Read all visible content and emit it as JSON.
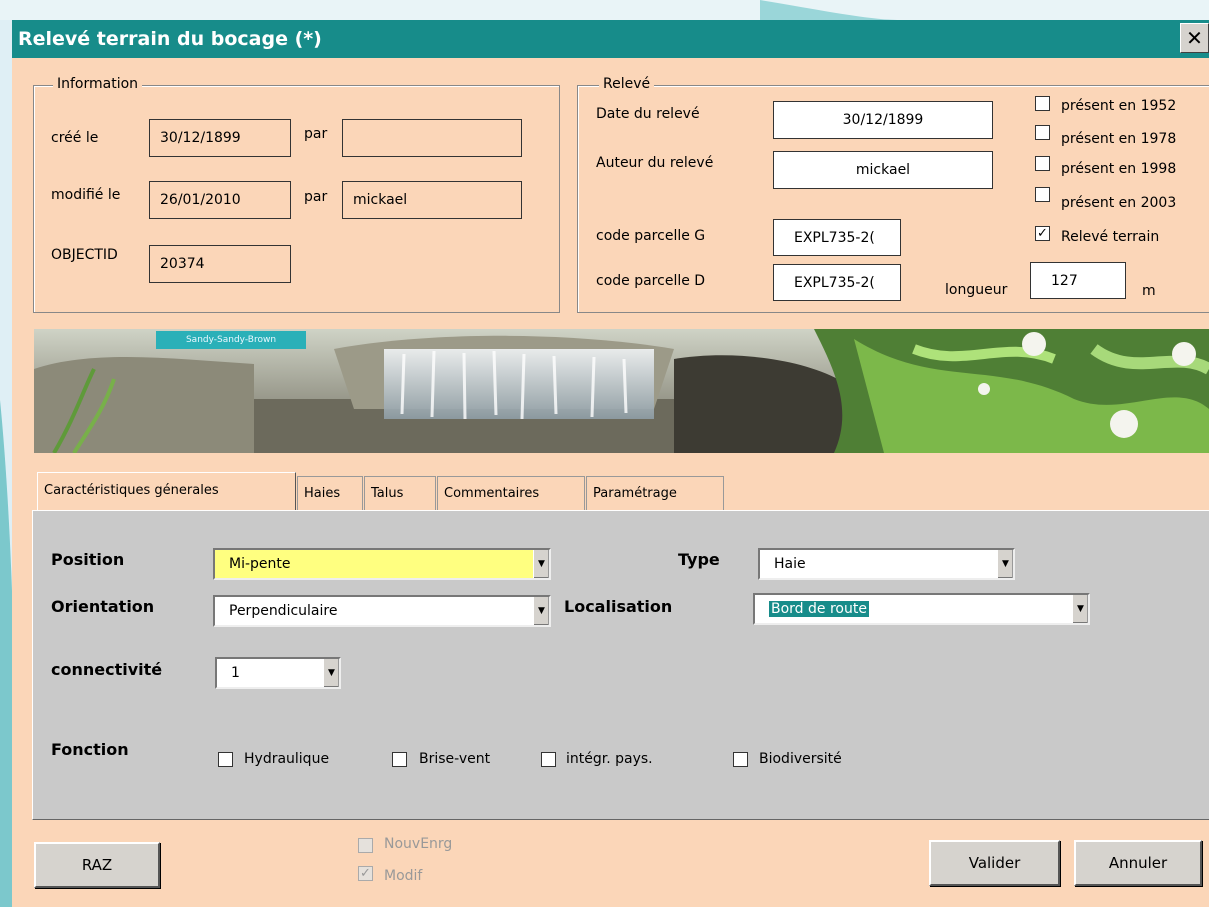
{
  "window": {
    "title": "Relevé terrain du bocage (*)",
    "close_glyph": "✕"
  },
  "information": {
    "legend": "Information",
    "cree_label": "créé le",
    "cree_value": "30/12/1899",
    "par1_label": "par",
    "par1_value": "",
    "modifie_label": "modifié le",
    "modifie_value": "26/01/2010",
    "par2_label": "par",
    "par2_value": "mickael",
    "objectid_label": "OBJECTID",
    "objectid_value": "20374"
  },
  "releve": {
    "legend": "Relevé",
    "date_label": "Date du relevé",
    "date_value": "30/12/1899",
    "auteur_label": "Auteur du relevé",
    "auteur_value": "mickael",
    "parcelle_g_label": "code parcelle G",
    "parcelle_g_value": "EXPL735-2(",
    "parcelle_d_label": "code parcelle D",
    "parcelle_d_value": "EXPL735-2(",
    "longueur_label": "longueur",
    "longueur_value": "127",
    "unit": "m",
    "checks": [
      {
        "label": "présent en 1952",
        "checked": false
      },
      {
        "label": "présent en 1978",
        "checked": false
      },
      {
        "label": "présent en 1998",
        "checked": false
      },
      {
        "label": "présent en 2003",
        "checked": false
      },
      {
        "label": "Relevé terrain",
        "checked": true
      }
    ]
  },
  "banner": {
    "label": "Sandy-Sandy-Brown"
  },
  "tabs": [
    {
      "label": "Caractéristiques génerales",
      "active": true
    },
    {
      "label": "Haies"
    },
    {
      "label": "Talus"
    },
    {
      "label": "Commentaires"
    },
    {
      "label": "Paramétrage"
    }
  ],
  "general": {
    "position_label": "Position",
    "position_value": "Mi-pente",
    "type_label": "Type",
    "type_value": "Haie",
    "orientation_label": "Orientation",
    "orientation_value": "Perpendiculaire",
    "localisation_label": "Localisation",
    "localisation_value": "Bord de route",
    "connectivite_label": "connectivité",
    "connectivite_value": "1",
    "fonction_label": "Fonction",
    "fonctions": [
      "Hydraulique",
      "Brise-vent",
      "intégr. pays.",
      "Biodiversité"
    ]
  },
  "footer": {
    "raz_label": "RAZ",
    "nouvenrg_label": "NouvEnrg",
    "modif_label": "Modif",
    "valider_label": "Valider",
    "annuler_label": "Annuler"
  },
  "colors": {
    "title_bg": "#178c8a",
    "dialog_bg": "#fbd6b8",
    "panel_bg": "#c9c9c9",
    "highlight": "#ffff80"
  }
}
